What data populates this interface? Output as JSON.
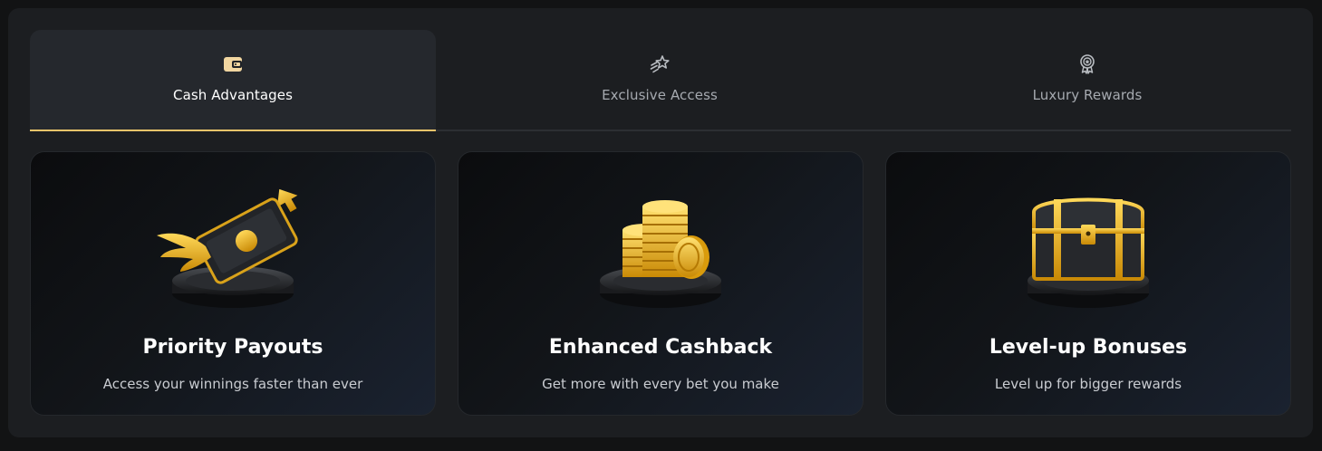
{
  "tabs": [
    {
      "label": "Cash Advantages",
      "icon": "wallet-icon",
      "active": true
    },
    {
      "label": "Exclusive Access",
      "icon": "shooting-star-icon",
      "active": false
    },
    {
      "label": "Luxury Rewards",
      "icon": "award-badge-icon",
      "active": false
    }
  ],
  "cards": [
    {
      "title": "Priority Payouts",
      "subtitle": "Access your winnings faster than ever",
      "image": "winged-cash-icon"
    },
    {
      "title": "Enhanced Cashback",
      "subtitle": "Get more with every bet you make",
      "image": "gold-coins-icon"
    },
    {
      "title": "Level-up Bonuses",
      "subtitle": "Level up for bigger rewards",
      "image": "treasure-chest-icon"
    }
  ],
  "colors": {
    "accent": "#e9c46a",
    "gold": "#f2b515",
    "background": "#1c1e21"
  }
}
